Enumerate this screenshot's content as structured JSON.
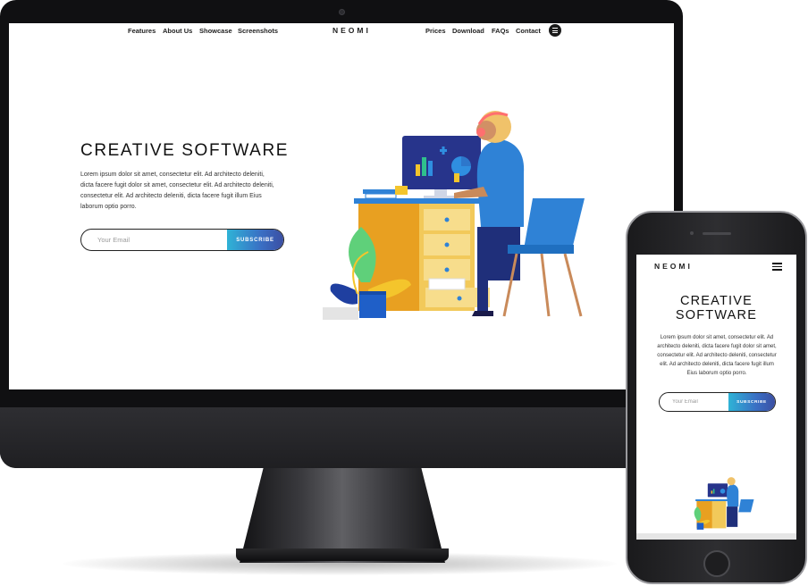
{
  "colors": {
    "accent_start": "#2fb3d6",
    "accent_end": "#3b4fa3",
    "text_dark": "#111111",
    "device_frame": "#1a1a1c"
  },
  "desktop": {
    "nav": {
      "left_items": [
        "Features",
        "About Us",
        "Showcase",
        "Screenshots"
      ],
      "logo": "NEOMI",
      "right_items": [
        "Prices",
        "Download",
        "FAQs",
        "Contact"
      ],
      "menu_icon": "hamburger-circle-icon"
    },
    "hero": {
      "title": "CREATIVE SOFTWARE",
      "text": "Lorem ipsum dolor sit amet, consectetur elit. Ad architecto deleniti, dicta facere fugit dolor sit amet, consectetur elit. Ad architecto deleniti, consectetur elit. Ad architecto deleniti, dicta facere fugit illum Eius laborum optio porro.",
      "email_placeholder": "Your Email",
      "subscribe_label": "SUBSCRIBE"
    }
  },
  "mobile": {
    "logo": "NEOMI",
    "menu_icon": "hamburger-icon",
    "title_line1": "CREATIVE",
    "title_line2": "SOFTWARE",
    "text": "Lorem ipsum dolor sit amet, consectetur elit. Ad architecto deleniti, dicta facere fugit dolor sit amet, consectetur elit. Ad architecto deleniti, consectetur elit. Ad architecto deleniti, dicta facere fugit illum Eius laborum optio porro.",
    "email_placeholder": "Your Email",
    "subscribe_label": "SUBSCRIBE"
  }
}
